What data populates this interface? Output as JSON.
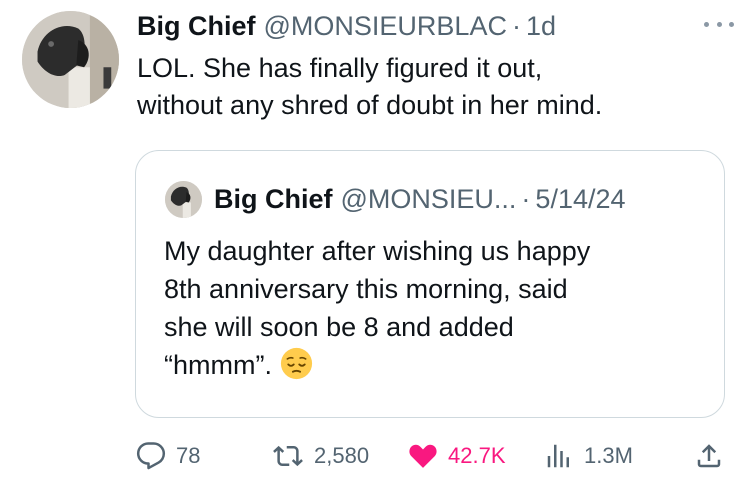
{
  "post": {
    "author_name": "Big Chief",
    "author_handle": "@MONSIEURBLAC",
    "separator": "·",
    "time": "1d",
    "more_icon": "more-horizontal-icon",
    "text_lines": [
      "LOL. She has finally figured it out,",
      "without any shred of doubt in her mind."
    ]
  },
  "quote": {
    "author_name": "Big Chief",
    "author_handle": "@MONSIEU...",
    "separator": "·",
    "date": "5/14/24",
    "text_lines": [
      "My daughter after wishing us happy",
      "8th anniversary this morning, said",
      "she will soon be 8 and added",
      "“hmmm”."
    ],
    "emoji": "pensive-face"
  },
  "actions": {
    "replies": "78",
    "reposts": "2,580",
    "likes": "42.7K",
    "views": "1.3M",
    "like_color": "#f91880",
    "icons": [
      "reply-icon",
      "repost-icon",
      "like-icon",
      "views-icon",
      "share-icon"
    ]
  },
  "colors": {
    "text": "#0f1419",
    "secondary": "#536471",
    "border": "#cfd9de"
  }
}
